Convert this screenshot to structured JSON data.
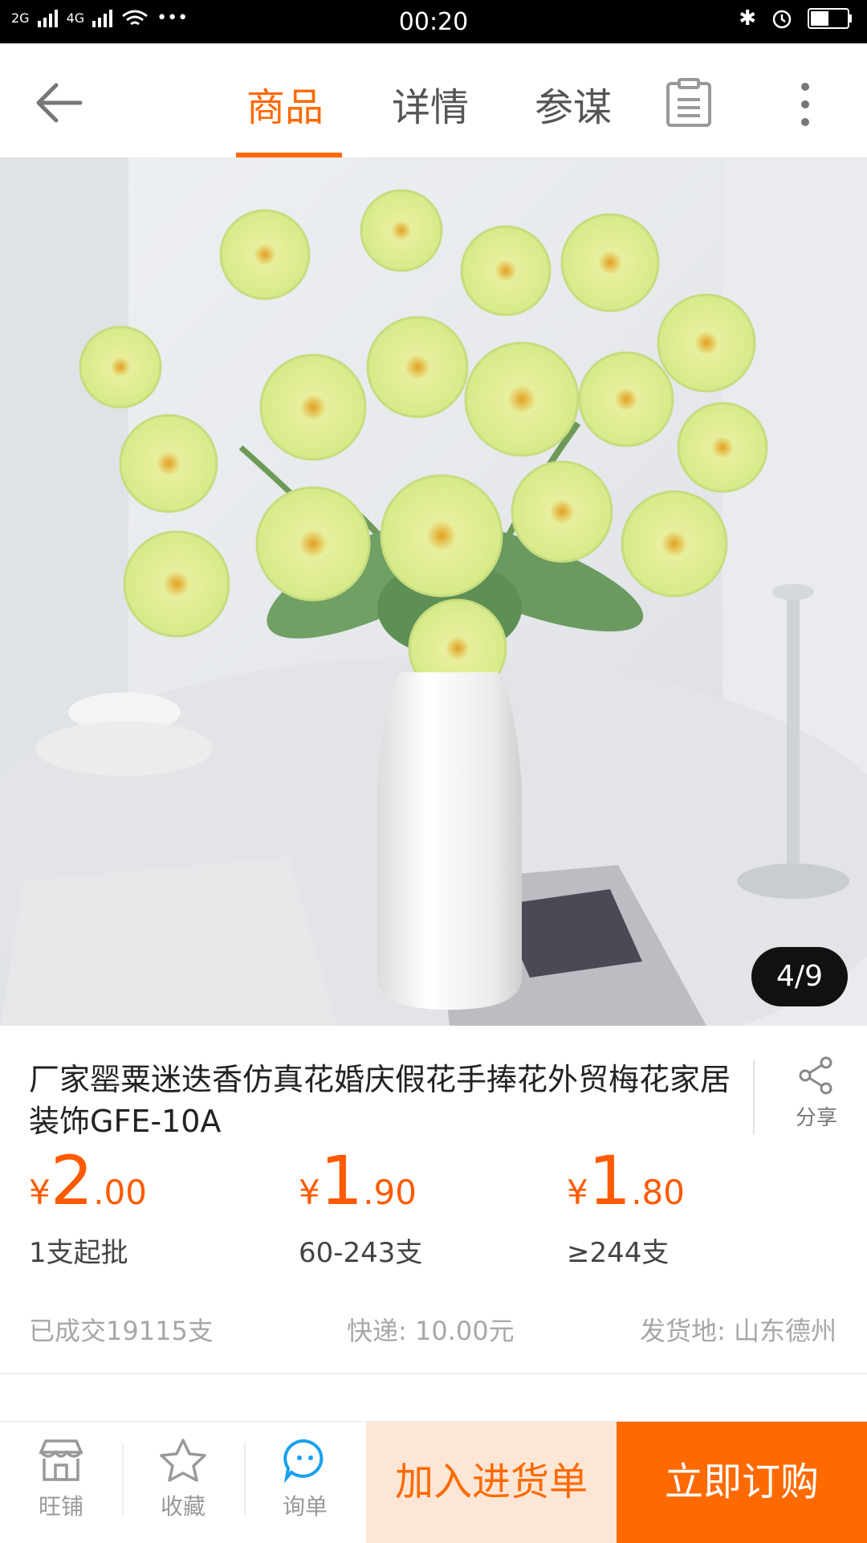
{
  "status_bar": {
    "time": "00:20",
    "signal1": "2G",
    "signal2": "4G",
    "dots": "•••"
  },
  "nav": {
    "tabs": [
      {
        "label": "商品",
        "active": true
      },
      {
        "label": "详情",
        "active": false
      },
      {
        "label": "参谋",
        "active": false
      }
    ],
    "icons": [
      "back-arrow-icon",
      "clipboard-icon",
      "more-vertical-icon"
    ],
    "accent_color": "#ff6a00"
  },
  "gallery": {
    "counter": "4/9"
  },
  "product": {
    "title": "厂家罂粟迷迭香仿真花婚庆假花手捧花外贸梅花家居装饰GFE-10A",
    "share_label": "分享"
  },
  "prices": [
    {
      "currency": "¥",
      "integer": "2",
      "decimal": ".00",
      "qty": "1支起批"
    },
    {
      "currency": "¥",
      "integer": "1",
      "decimal": ".90",
      "qty": "60-243支"
    },
    {
      "currency": "¥",
      "integer": "1",
      "decimal": ".80",
      "qty": "≥244支"
    }
  ],
  "meta": {
    "sold": "已成交19115支",
    "shipping": "快递: 10.00元",
    "origin": "发货地: 山东德州"
  },
  "bottom_bar": {
    "shop_label": "旺铺",
    "fav_label": "收藏",
    "inquiry_label": "询单",
    "add_cart_label": "加入进货单",
    "buy_now_label": "立即订购"
  }
}
